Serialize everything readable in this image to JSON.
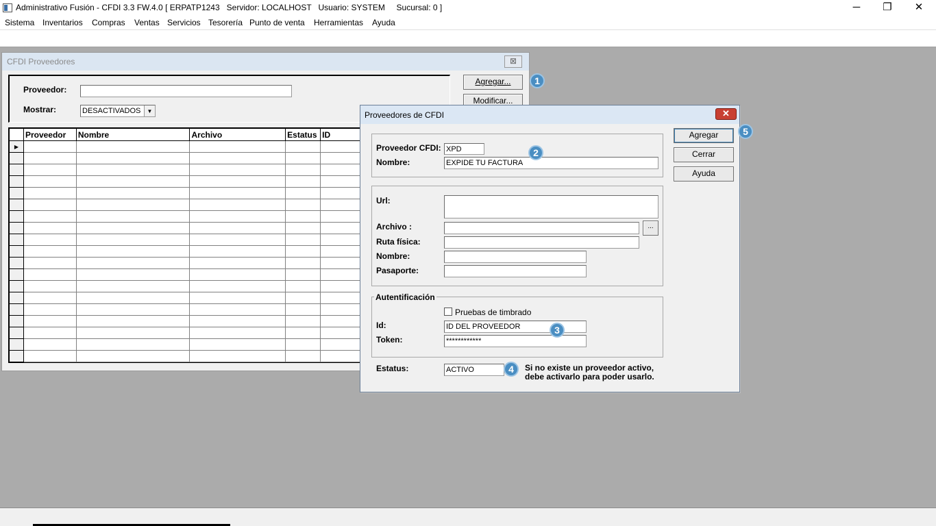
{
  "app": {
    "title": "Administrativo Fusión - CFDI 3.3 FW.4.0 [ ERPATP1243   Servidor: LOCALHOST   Usuario: SYSTEM     Sucursal: 0 ]",
    "window_controls": {
      "minimize": "─",
      "restore": "❐",
      "close": "✕"
    },
    "menu": [
      "Sistema",
      "Inventarios",
      "Compras",
      "Ventas",
      "Servicios",
      "Tesorería",
      "Punto de venta",
      "Herramientas",
      "Ayuda"
    ]
  },
  "providers_window": {
    "title": "CFDI Proveedores",
    "close_glyph": "⊠",
    "proveedor_label": "Proveedor:",
    "proveedor_value": "",
    "mostrar_label": "Mostrar:",
    "mostrar_value": "DESACTIVADOS",
    "add_button": "Agregar...",
    "modify_button": "Modificar...",
    "columns": [
      "Proveedor",
      "Nombre",
      "Archivo",
      "Estatus",
      "ID"
    ],
    "row_indicator": "▶"
  },
  "dialog": {
    "title": "Proveedores de CFDI",
    "close_glyph": "✕",
    "proveedor_cfdi_label": "Proveedor CFDI:",
    "proveedor_cfdi_value": "XPD",
    "nombre_label": "Nombre:",
    "nombre_value": "EXPIDE TU FACTURA",
    "url_label": "Url:",
    "url_value": "",
    "archivo_label": "Archivo :",
    "archivo_value": "",
    "browse_button": "...",
    "ruta_label": "Ruta física:",
    "ruta_value": "",
    "nombre2_label": "Nombre:",
    "nombre2_value": "",
    "pasaporte_label": "Pasaporte:",
    "pasaporte_value": "",
    "auth_group": "Autentificación",
    "pruebas_label": "Pruebas de timbrado",
    "pruebas_checked": false,
    "id_label": "Id:",
    "id_value": "ID DEL PROVEEDOR",
    "token_label": "Token:",
    "token_value": "************",
    "estatus_label": "Estatus:",
    "estatus_value": "ACTIVO",
    "note_line1": "Si no existe un proveedor activo,",
    "note_line2": "debe activarlo para poder usarlo.",
    "agregar_button": "Agregar",
    "cerrar_button": "Cerrar",
    "ayuda_button": "Ayuda"
  },
  "badges": [
    "1",
    "2",
    "3",
    "4",
    "5"
  ],
  "colors": {
    "badge": "#4a8ec2",
    "close_red": "#c84033",
    "desktop": "#ababab"
  }
}
